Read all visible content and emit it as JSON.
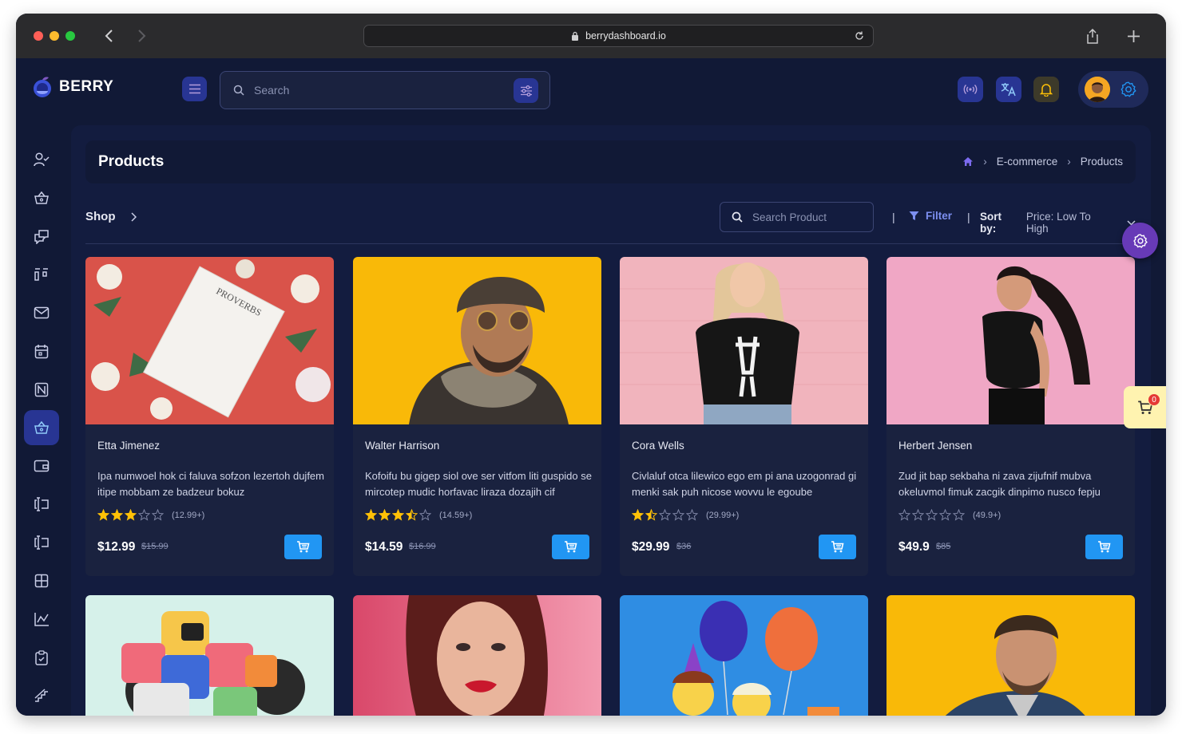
{
  "browser": {
    "url": "berrydashboard.io"
  },
  "app": {
    "brand": "BERRY",
    "search_placeholder": "Search"
  },
  "page": {
    "title": "Products",
    "breadcrumbs": [
      "E-commerce",
      "Products"
    ]
  },
  "toolbar": {
    "shop_label": "Shop",
    "product_search_placeholder": "Search Product",
    "filter_label": "Filter",
    "sort_label": "Sort by:",
    "sort_value": "Price: Low To High"
  },
  "cart": {
    "count": "0"
  },
  "colors": {
    "primary": "#2196f3",
    "accent_purple": "#673ab7",
    "star": "#ffc107",
    "background": "#111936"
  },
  "products": [
    {
      "name": "Etta Jimenez",
      "description": "Ipa numwoel hok ci faluva sofzon lezertoh dujfem itipe mobbam ze badzeur bokuz",
      "rating": 3,
      "reviews": "(12.99+)",
      "price": "$12.99",
      "old_price": "$15.99",
      "image": "book-on-red-with-flowers"
    },
    {
      "name": "Walter Harrison",
      "description": "Kofoifu bu gigep siol ove ser vitfom liti guspido se mircotep mudic horfavac liraza dozajih cif",
      "rating": 3.5,
      "reviews": "(14.59+)",
      "price": "$14.59",
      "old_price": "$16.99",
      "image": "man-in-beanie-on-yellow"
    },
    {
      "name": "Cora Wells",
      "description": "Civlaluf otca lilewico ego em pi ana uzogonrad gi menki sak puh nicose wovvu le egoube",
      "rating": 1.5,
      "reviews": "(29.99+)",
      "price": "$29.99",
      "old_price": "$36",
      "image": "woman-skeleton-tee-pink-wall"
    },
    {
      "name": "Herbert Jensen",
      "description": "Zud jit bap sekbaha ni zava zijufnif mubva okeluvmol fimuk zacgik dinpimo nusco fepju",
      "rating": 0,
      "reviews": "(49.9+)",
      "price": "$49.9",
      "old_price": "$85",
      "image": "woman-black-top-pink"
    },
    {
      "image": "robot-toy-mint"
    },
    {
      "image": "woman-red-lips-pink"
    },
    {
      "image": "lego-figures-balloons-blue"
    },
    {
      "image": "man-blue-suit-yellow"
    }
  ]
}
